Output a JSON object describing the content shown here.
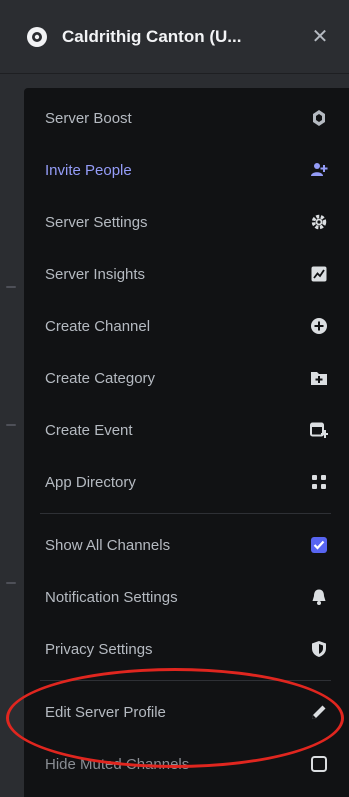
{
  "header": {
    "server_name": "Caldrithig Canton (U...",
    "close_glyph": "✕"
  },
  "menu": {
    "groups": [
      [
        {
          "label": "Server Boost",
          "icon": "boost-icon"
        },
        {
          "label": "Invite People",
          "icon": "add-user-icon",
          "highlight": true
        },
        {
          "label": "Server Settings",
          "icon": "gear-icon"
        },
        {
          "label": "Server Insights",
          "icon": "insights-icon"
        },
        {
          "label": "Create Channel",
          "icon": "plus-circle-icon"
        },
        {
          "label": "Create Category",
          "icon": "folder-plus-icon"
        },
        {
          "label": "Create Event",
          "icon": "calendar-plus-icon"
        },
        {
          "label": "App Directory",
          "icon": "app-grid-icon"
        }
      ],
      [
        {
          "label": "Show All Channels",
          "icon": "checkbox-checked-icon"
        },
        {
          "label": "Notification Settings",
          "icon": "bell-icon"
        },
        {
          "label": "Privacy Settings",
          "icon": "shield-icon"
        }
      ],
      [
        {
          "label": "Edit Server Profile",
          "icon": "pencil-icon"
        },
        {
          "label": "Hide Muted Channels",
          "icon": "checkbox-empty-icon"
        }
      ]
    ]
  },
  "colors": {
    "highlight": "#949cf7",
    "checkbox": "#5865f2",
    "annotation": "#e0261f",
    "menu_bg": "#111214"
  }
}
